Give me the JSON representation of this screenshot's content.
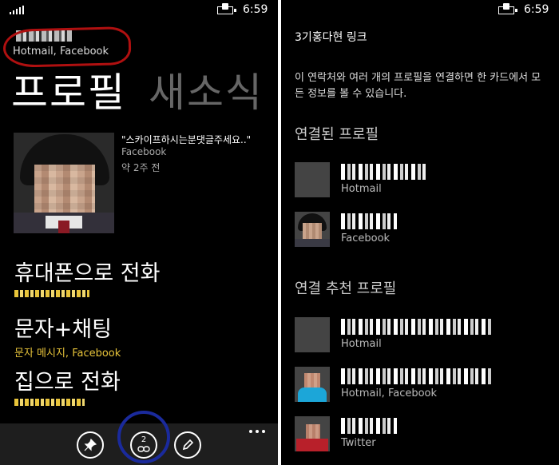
{
  "left": {
    "status_bar": {
      "time": "6:59"
    },
    "account": {
      "sources": "Hotmail, Facebook"
    },
    "pivot": {
      "active": "프로필",
      "inactive": "새소식"
    },
    "latest_status": {
      "text": "\"스카이프하시는분댓글주세요..\"",
      "source": "Facebook",
      "time": "약 2주 전"
    },
    "actions": [
      {
        "title": "휴대폰으로 전화"
      },
      {
        "title": "문자+채팅",
        "subtitle": "문자 메시지, Facebook"
      },
      {
        "title": "집으로 전화"
      }
    ],
    "app_bar": {
      "link_count": "2"
    }
  },
  "right": {
    "status_bar": {
      "time": "6:59"
    },
    "title": "3기홍다현 링크",
    "description": "이 연락처와 여러 개의 프로필을 연결하면 한 카드에서 모든 정보를 볼 수 있습니다.",
    "linked_section": "연결된 프로필",
    "linked_profiles": [
      {
        "service": "Hotmail"
      },
      {
        "service": "Facebook"
      }
    ],
    "suggested_section": "연결 추천 프로필",
    "suggested_profiles": [
      {
        "service": "Hotmail"
      },
      {
        "service": "Hotmail, Facebook"
      },
      {
        "service": "Twitter"
      }
    ]
  }
}
